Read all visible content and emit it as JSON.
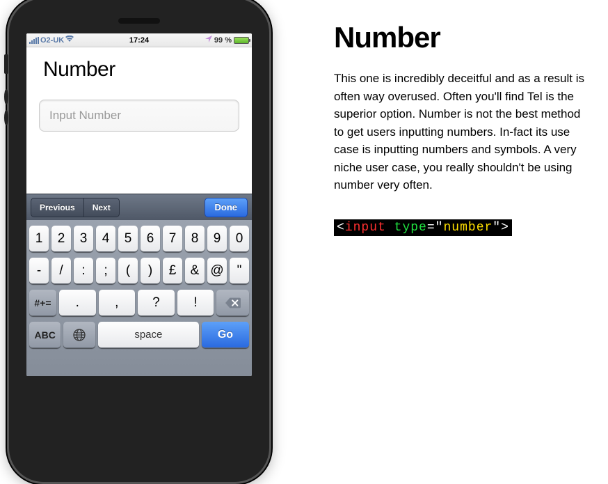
{
  "statusbar": {
    "carrier": "O2-UK",
    "time": "17:24",
    "battery_pct": "99 %"
  },
  "screen": {
    "title": "Number",
    "input_placeholder": "Input Number"
  },
  "accessory": {
    "prev": "Previous",
    "next": "Next",
    "done": "Done"
  },
  "keyboard": {
    "row1": [
      "1",
      "2",
      "3",
      "4",
      "5",
      "6",
      "7",
      "8",
      "9",
      "0"
    ],
    "row2": [
      "-",
      "/",
      ":",
      ";",
      "(",
      ")",
      "£",
      "&",
      "@",
      "\""
    ],
    "row3_mod": "#+=",
    "row3": [
      ".",
      ",",
      "?",
      "!"
    ],
    "row4_abc": "ABC",
    "row4_space": "space",
    "row4_go": "Go"
  },
  "article": {
    "title": "Number",
    "body": "This one is incredibly deceitful and as a result is often way overused. Often you'll find Tel is the superior option. Number is not the best method to get users inputting numbers. In-fact its use case is inputting numbers and symbols. A very niche user case, you really shouldn't be using number very often.",
    "code": {
      "open": "<",
      "tag": "input",
      "attr": "type",
      "eq": "=",
      "q1": "\"",
      "val": "number",
      "q2": "\"",
      "close": ">"
    }
  }
}
